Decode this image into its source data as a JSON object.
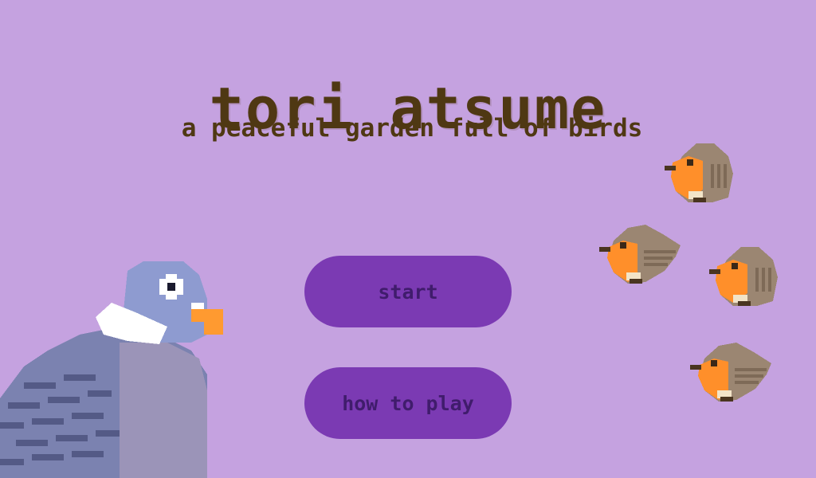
{
  "title": "tori atsume",
  "subtitle": "a peaceful garden full of birds",
  "menu": {
    "start_label": "start",
    "how_to_play_label": "how to play"
  },
  "colors": {
    "background": "#c5a2e0",
    "title_text": "#4f3813",
    "button_fill": "#7b3ab3",
    "button_text": "#401c6c"
  },
  "sprites": {
    "pigeon": "pigeon-sprite",
    "robin": "robin-sprite"
  }
}
